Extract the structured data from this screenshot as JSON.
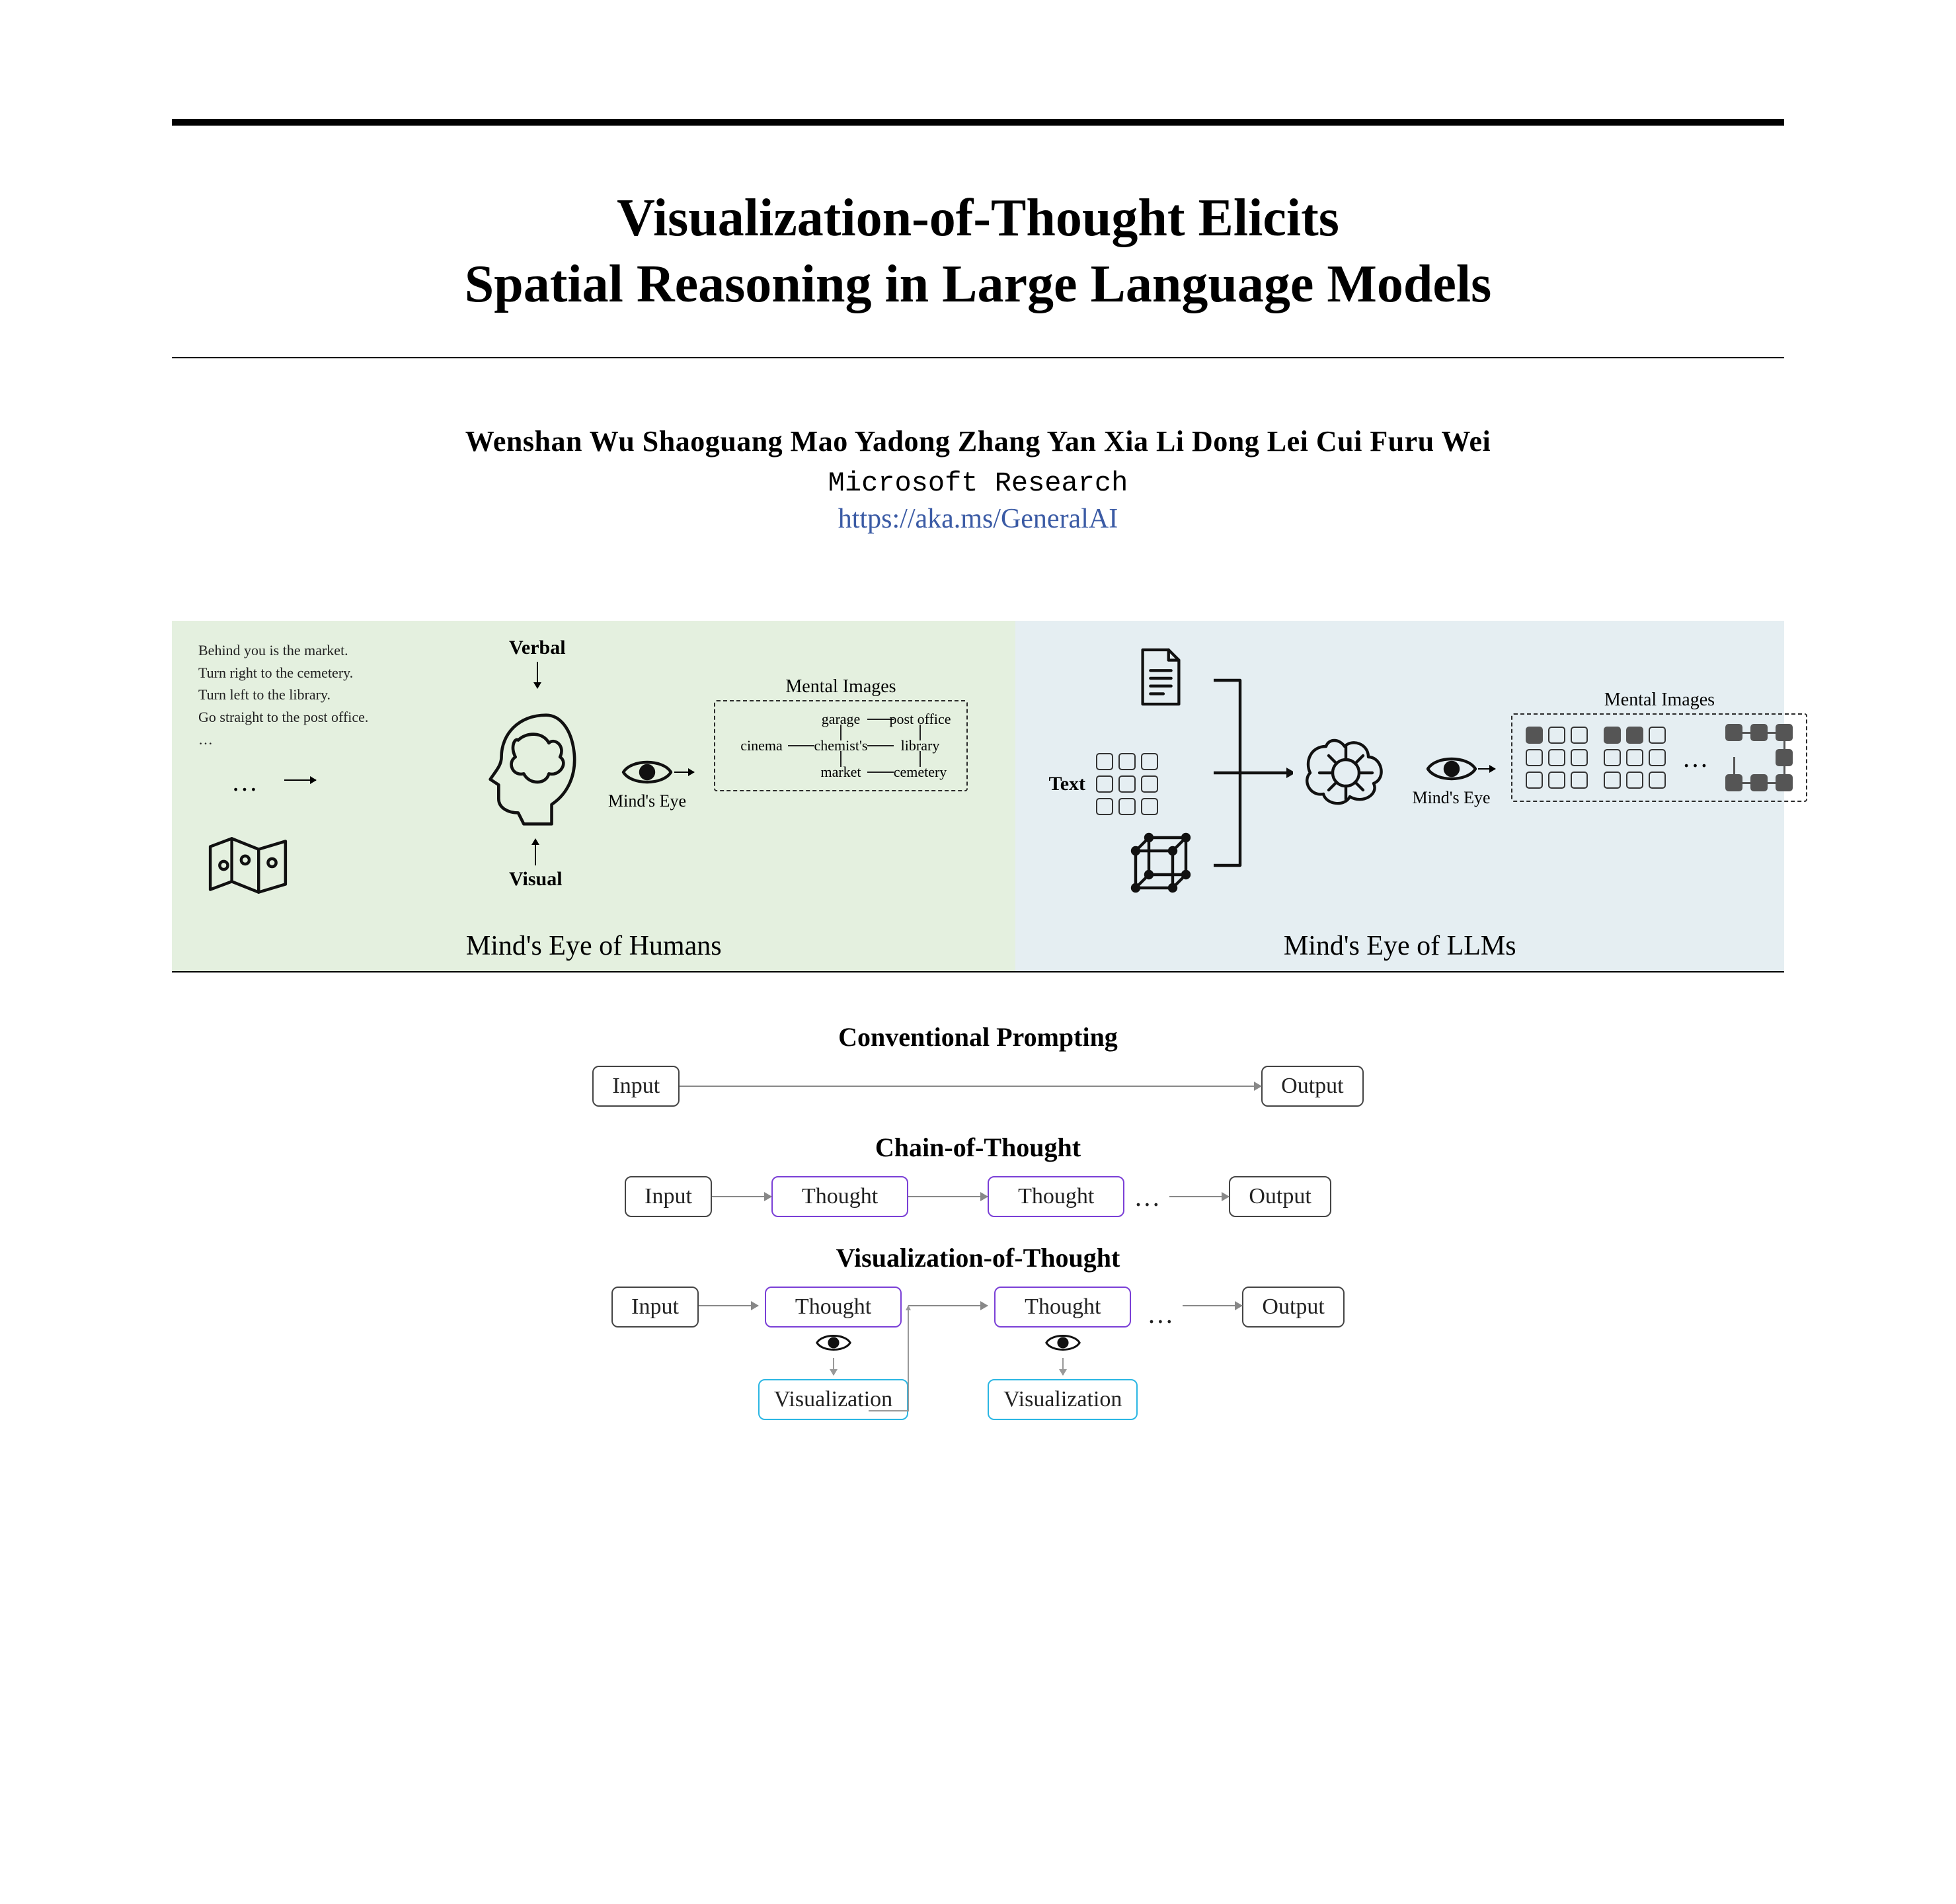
{
  "title_line1": "Visualization-of-Thought Elicits",
  "title_line2": "Spatial Reasoning in Large Language Models",
  "authors": "Wenshan Wu   Shaoguang Mao   Yadong Zhang   Yan Xia   Li Dong   Lei Cui   Furu Wei",
  "affiliation": "Microsoft Research",
  "link": "https://aka.ms/GeneralAI",
  "panel_left": {
    "caption": "Mind's Eye of Humans",
    "instructions": [
      "Behind you is the market.",
      "Turn right to the cemetery.",
      "Turn left to the library.",
      "Go straight to the post office.",
      "…"
    ],
    "verbal": "Verbal",
    "visual": "Visual",
    "minds_eye": "Mind's Eye",
    "mental_label": "Mental Images",
    "map": {
      "r0": [
        "",
        "garage",
        "post office"
      ],
      "r1": [
        "cinema",
        "chemist's",
        "library"
      ],
      "r2": [
        "",
        "market",
        "cemetery"
      ]
    }
  },
  "panel_right": {
    "caption": "Mind's Eye of LLMs",
    "text_label": "Text",
    "minds_eye": "Mind's Eye",
    "mental_label": "Mental Images"
  },
  "prompting": {
    "conventional": {
      "title": "Conventional Prompting",
      "input": "Input",
      "output": "Output"
    },
    "cot": {
      "title": "Chain-of-Thought",
      "input": "Input",
      "thought": "Thought",
      "output": "Output"
    },
    "vot": {
      "title": "Visualization-of-Thought",
      "input": "Input",
      "thought": "Thought",
      "visualization": "Visualization",
      "output": "Output"
    }
  }
}
